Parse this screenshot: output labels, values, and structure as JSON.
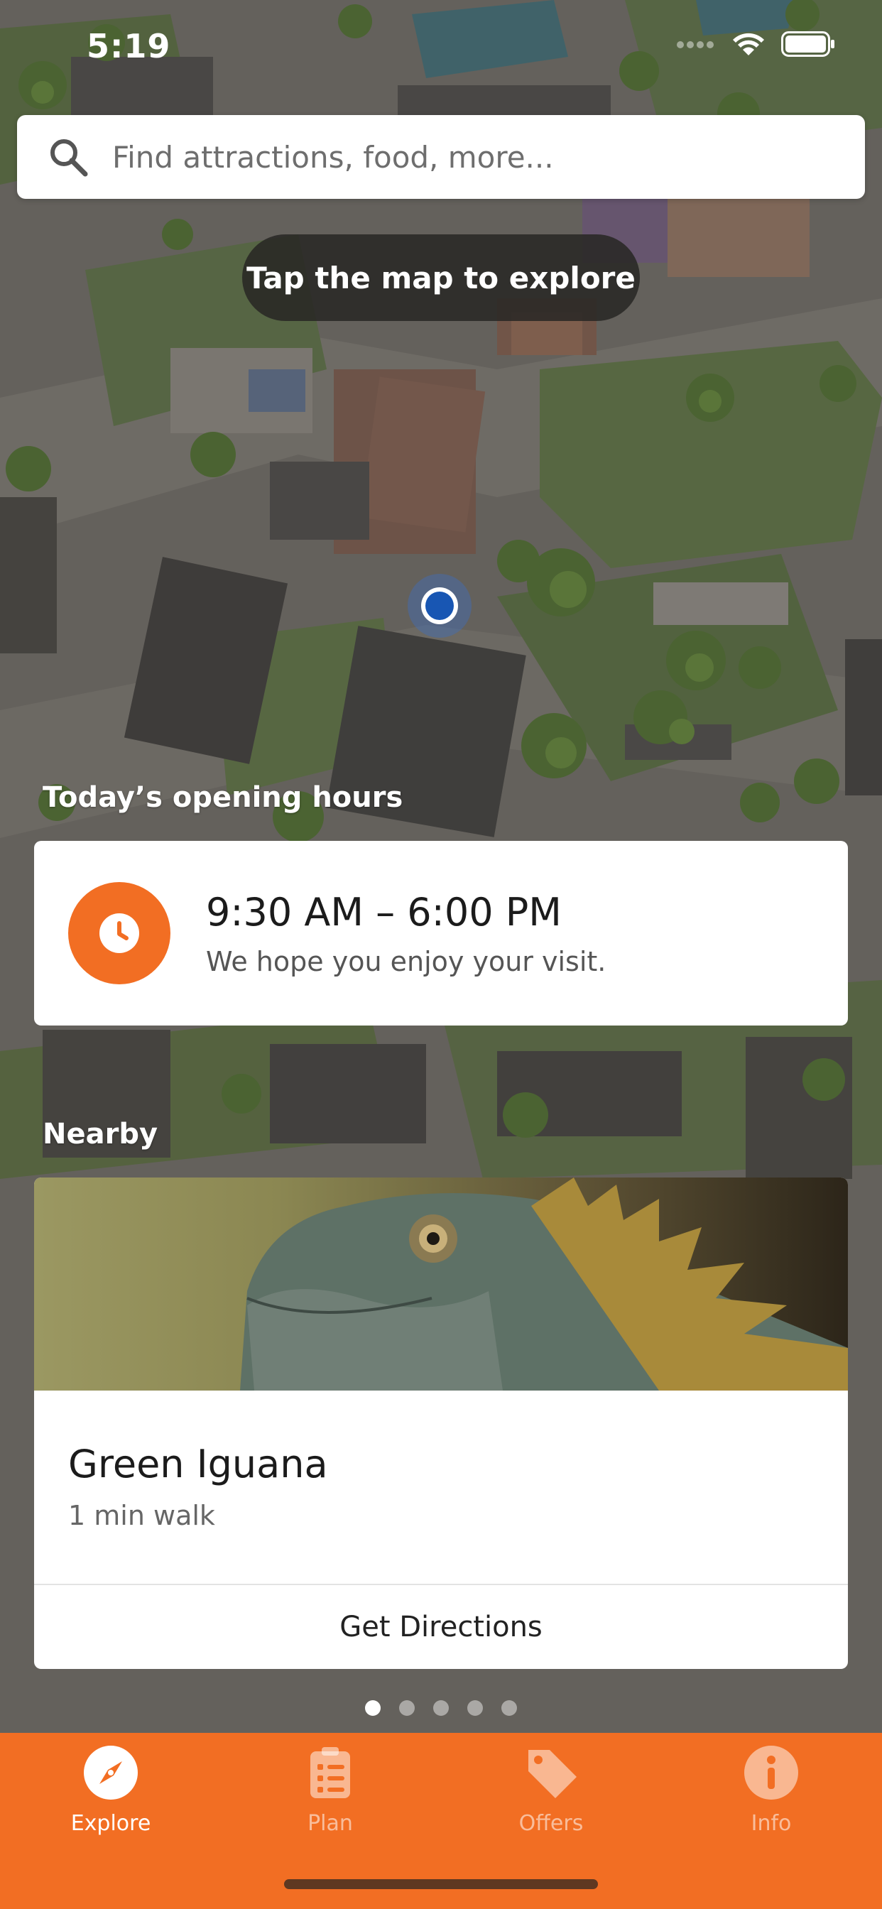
{
  "status_bar": {
    "time": "5:19",
    "icons": [
      "signal-icon",
      "wifi-icon",
      "battery-icon"
    ]
  },
  "search": {
    "placeholder": "Find attractions, food, more...",
    "value": ""
  },
  "map": {
    "hint": "Tap the map to explore"
  },
  "opening_hours": {
    "section_title": "Today’s opening hours",
    "hours": "9:30 AM – 6:00 PM",
    "message": "We hope you enjoy your visit.",
    "icon": "clock-icon"
  },
  "nearby": {
    "section_title": "Nearby",
    "items": [
      {
        "name": "Green Iguana",
        "distance": "1 min walk",
        "action": "Get Directions"
      }
    ],
    "pager": {
      "count": 5,
      "active": 0
    }
  },
  "tabs": [
    {
      "label": "Explore",
      "icon": "compass-icon",
      "active": true
    },
    {
      "label": "Plan",
      "icon": "checklist-icon",
      "active": false
    },
    {
      "label": "Offers",
      "icon": "tag-icon",
      "active": false
    },
    {
      "label": "Info",
      "icon": "info-icon",
      "active": false
    }
  ],
  "colors": {
    "accent": "#f26e23",
    "location": "#1856b3"
  }
}
